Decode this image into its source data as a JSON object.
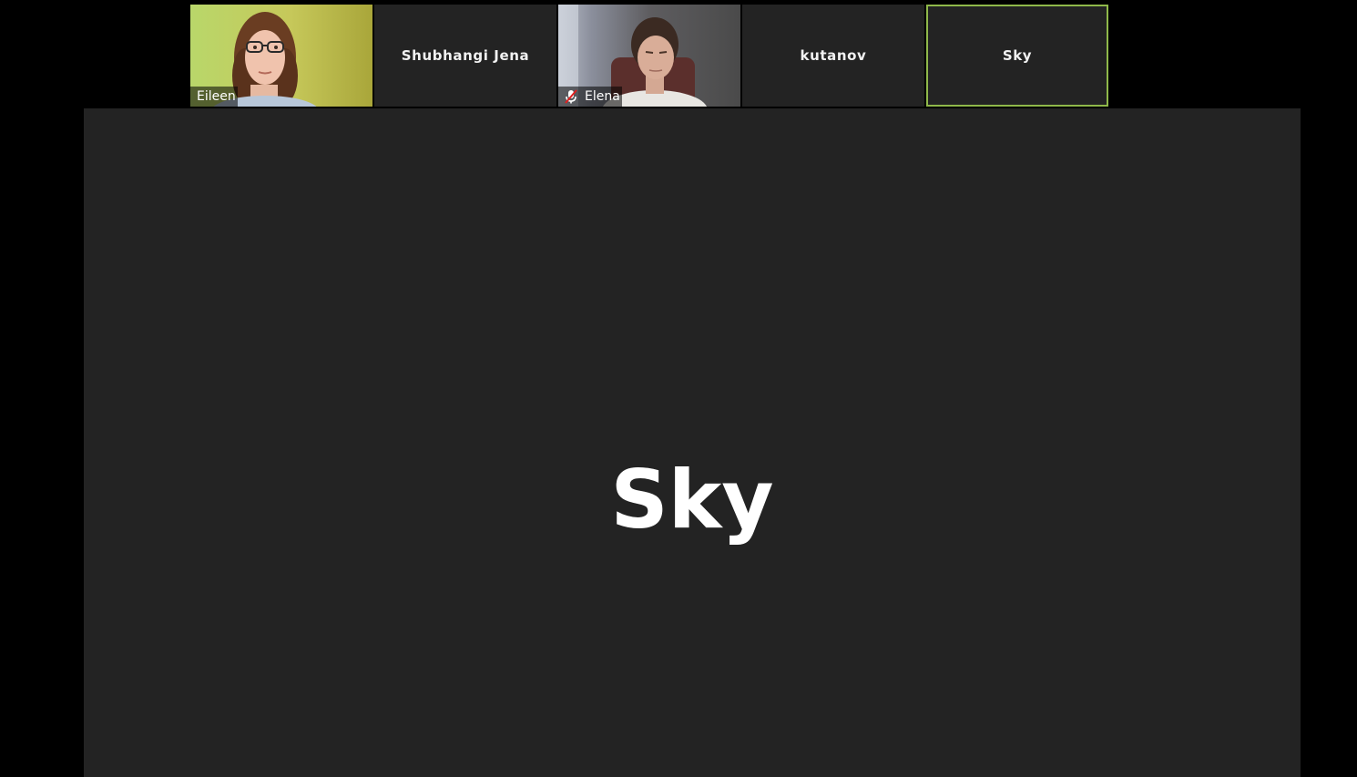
{
  "participants": [
    {
      "name": "Eileen",
      "video": true,
      "muted": false,
      "active": false
    },
    {
      "name": "Shubhangi Jena",
      "video": false,
      "muted": false,
      "active": false
    },
    {
      "name": "Elena",
      "video": true,
      "muted": true,
      "active": false
    },
    {
      "name": "kutanov",
      "video": false,
      "muted": false,
      "active": false
    },
    {
      "name": "Sky",
      "video": false,
      "muted": false,
      "active": true
    }
  ],
  "speaker_view": {
    "name": "Sky"
  },
  "colors": {
    "background": "#000000",
    "tile": "#232323",
    "active_border": "#8fb84a",
    "muted_icon": "#e02020"
  }
}
